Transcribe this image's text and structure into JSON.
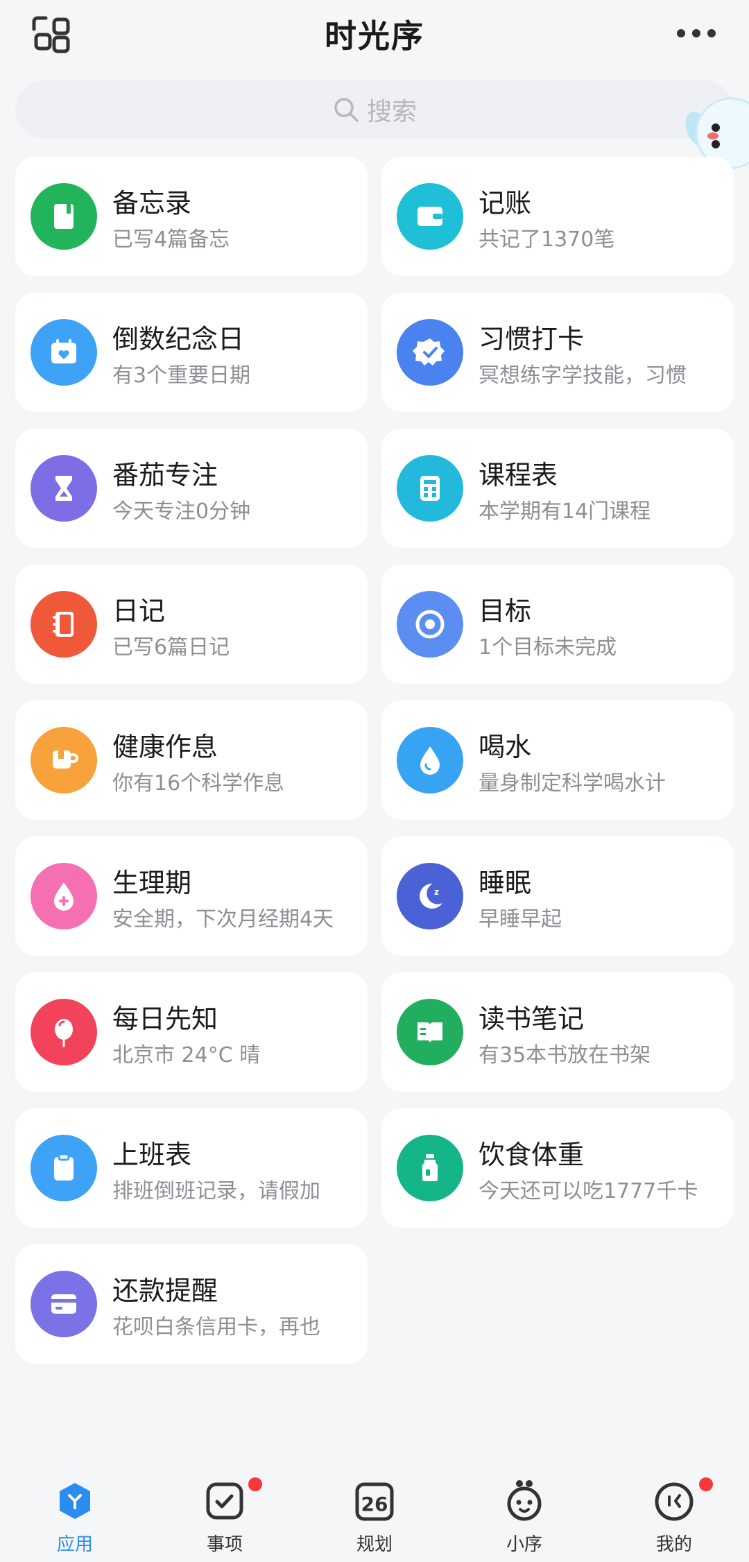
{
  "header": {
    "title": "时光序",
    "search_placeholder": "搜索"
  },
  "cards": [
    {
      "name": "备忘录",
      "sub": "已写4篇备忘",
      "color": "#22b45a",
      "icon": "notebook-icon"
    },
    {
      "name": "记账",
      "sub": "共记了1370笔",
      "color": "#1fbfd8",
      "icon": "wallet-icon"
    },
    {
      "name": "倒数纪念日",
      "sub": "有3个重要日期",
      "color": "#3ea3f7",
      "icon": "calendar-heart-icon"
    },
    {
      "name": "习惯打卡",
      "sub": "冥想练字学技能，习惯",
      "color": "#4a82f0",
      "icon": "badge-check-icon"
    },
    {
      "name": "番茄专注",
      "sub": "今天专注0分钟",
      "color": "#7d6ee6",
      "icon": "hourglass-icon"
    },
    {
      "name": "课程表",
      "sub": "本学期有14门课程",
      "color": "#23b9dc",
      "icon": "calculator-icon"
    },
    {
      "name": "日记",
      "sub": "已写6篇日记",
      "color": "#f0583a",
      "icon": "diary-icon"
    },
    {
      "name": "目标",
      "sub": "1个目标未完成",
      "color": "#5b8df2",
      "icon": "target-icon"
    },
    {
      "name": "健康作息",
      "sub": "你有16个科学作息",
      "color": "#f7a23a",
      "icon": "cup-icon"
    },
    {
      "name": "喝水",
      "sub": "量身制定科学喝水计",
      "color": "#36a4f2",
      "icon": "water-drop-icon"
    },
    {
      "name": "生理期",
      "sub": "安全期，下次月经期4天",
      "color": "#f570b2",
      "icon": "blood-drop-plus-icon"
    },
    {
      "name": "睡眠",
      "sub": "早睡早起",
      "color": "#4b62d6",
      "icon": "moon-icon"
    },
    {
      "name": "每日先知",
      "sub": "北京市 24°C 晴",
      "color": "#f2435a",
      "icon": "balloon-icon"
    },
    {
      "name": "读书笔记",
      "sub": "有35本书放在书架",
      "color": "#21ae5f",
      "icon": "book-icon"
    },
    {
      "name": "上班表",
      "sub": "排班倒班记录，请假加",
      "color": "#3ea3f7",
      "icon": "clipboard-icon"
    },
    {
      "name": "饮食体重",
      "sub": "今天还可以吃1777千卡",
      "color": "#15b58a",
      "icon": "bottle-icon"
    },
    {
      "name": "还款提醒",
      "sub": "花呗白条信用卡，再也",
      "color": "#7b72e8",
      "icon": "credit-card-icon"
    }
  ],
  "nav": [
    {
      "label": "应用",
      "icon": "apps-icon",
      "active": true
    },
    {
      "label": "事项",
      "icon": "todo-check-icon",
      "active": false
    },
    {
      "label": "规划",
      "icon": "calendar-26-icon",
      "active": false,
      "badge_text": "26"
    },
    {
      "label": "小序",
      "icon": "mascot-icon",
      "active": false
    },
    {
      "label": "我的",
      "icon": "profile-face-icon",
      "active": false
    }
  ],
  "colors": {
    "accent": "#2c8cf0",
    "badge": "#f5393a",
    "background": "#f5f6f8"
  }
}
